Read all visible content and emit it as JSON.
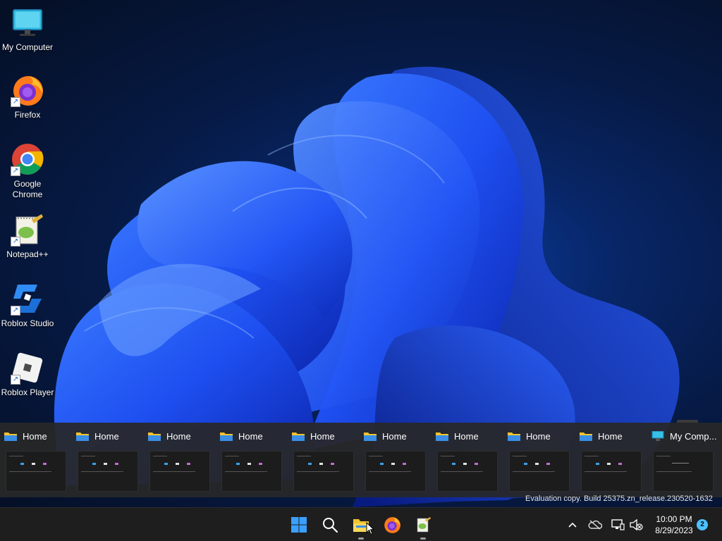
{
  "desktop": {
    "icons": [
      {
        "label": "My Computer",
        "icon": "monitor-icon",
        "shortcut": false
      },
      {
        "label": "Firefox",
        "icon": "firefox-icon",
        "shortcut": true
      },
      {
        "label": "Google Chrome",
        "icon": "chrome-icon",
        "shortcut": true
      },
      {
        "label": "Notepad++",
        "icon": "notepadpp-icon",
        "shortcut": true
      },
      {
        "label": "Roblox Studio",
        "icon": "roblox-studio-icon",
        "shortcut": true
      },
      {
        "label": "Roblox Player",
        "icon": "roblox-player-icon",
        "shortcut": true
      }
    ]
  },
  "task_preview": {
    "windows": [
      {
        "title": "Home",
        "icon": "folder-icon"
      },
      {
        "title": "Home",
        "icon": "folder-icon"
      },
      {
        "title": "Home",
        "icon": "folder-icon"
      },
      {
        "title": "Home",
        "icon": "folder-icon"
      },
      {
        "title": "Home",
        "icon": "folder-icon"
      },
      {
        "title": "Home",
        "icon": "folder-icon"
      },
      {
        "title": "Home",
        "icon": "folder-icon"
      },
      {
        "title": "Home",
        "icon": "folder-icon"
      },
      {
        "title": "Home",
        "icon": "folder-icon"
      },
      {
        "title": "My Comp...",
        "icon": "monitor-icon"
      }
    ]
  },
  "watermark": "Evaluation copy. Build 25375.zn_release.230520-1632",
  "taskbar": {
    "apps": [
      {
        "name": "Start",
        "icon": "windows-start-icon",
        "running": false
      },
      {
        "name": "Search",
        "icon": "search-icon",
        "running": false
      },
      {
        "name": "File Explorer",
        "icon": "file-explorer-icon",
        "running": true
      },
      {
        "name": "Firefox",
        "icon": "firefox-icon",
        "running": false
      },
      {
        "name": "Notepad++",
        "icon": "notepadpp-icon",
        "running": true
      }
    ],
    "tray": {
      "icons": [
        "chevron-up-icon",
        "onedrive-icon",
        "network-icon",
        "volume-muted-icon"
      ],
      "time": "10:00 PM",
      "date": "8/29/2023",
      "notifications": "2"
    }
  },
  "colors": {
    "accent": "#4cc2ff",
    "taskbar": "#1e1e1f",
    "folder": "#f4c430"
  }
}
